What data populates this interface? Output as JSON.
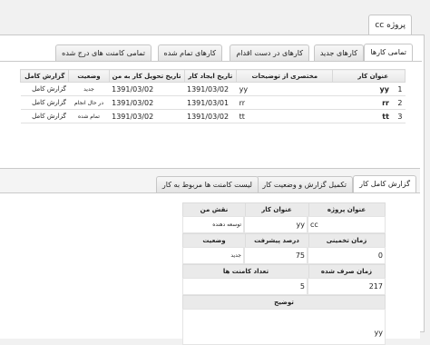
{
  "window": {
    "title": "پروژه cc"
  },
  "main_tabs": [
    {
      "label": "تمامی کارها"
    },
    {
      "label": "کارهای جدید"
    },
    {
      "label": "کارهای در دست اقدام"
    },
    {
      "label": "کارهای تمام شده"
    },
    {
      "label": "تمامی کامنت های درج شده"
    }
  ],
  "task_table": {
    "columns": [
      "عنوان کار",
      "مختصری از توضیحات",
      "تاریخ ایجاد کار",
      "تاریخ تحویل کار به من",
      "وضعیت",
      "گزارش کامل"
    ],
    "rows": [
      {
        "num": "1",
        "title": "yy",
        "desc": "yy",
        "created": "1391/03/02",
        "due": "1391/03/02",
        "status": "جدید",
        "report": "گزارش کامل"
      },
      {
        "num": "2",
        "title": "rr",
        "desc": "rr",
        "created": "1391/03/01",
        "due": "1391/03/02",
        "status": "در حال انجام",
        "report": "گزارش کامل"
      },
      {
        "num": "3",
        "title": "tt",
        "desc": "tt",
        "created": "1391/03/02",
        "due": "1391/03/02",
        "status": "تمام شده",
        "report": "گزارش کامل"
      }
    ]
  },
  "detail_tabs": [
    {
      "label": "گزارش کامل کار"
    },
    {
      "label": "تکمیل گزارش و وضعیت کار"
    },
    {
      "label": "لیست کامنت ها مربوط به کار"
    }
  ],
  "details": {
    "project_title_label": "عنوان پروژه",
    "project_title_value": "cc",
    "task_title_label": "عنوان کار",
    "task_title_value": "yy",
    "my_role_label": "نقش من",
    "my_role_value": "توسعه دهنده",
    "estimated_time_label": "زمان تخمینی",
    "estimated_time_value": "0",
    "progress_label": "درصد پیشرفت",
    "progress_value": "75",
    "status_label": "وضعیت",
    "status_value": "جدید",
    "spent_time_label": "زمان صرف شده",
    "spent_time_value": "217",
    "comment_count_label": "تعداد کامنت ها",
    "comment_count_value": "5",
    "description_label": "توضیح",
    "description_value": "yy"
  }
}
